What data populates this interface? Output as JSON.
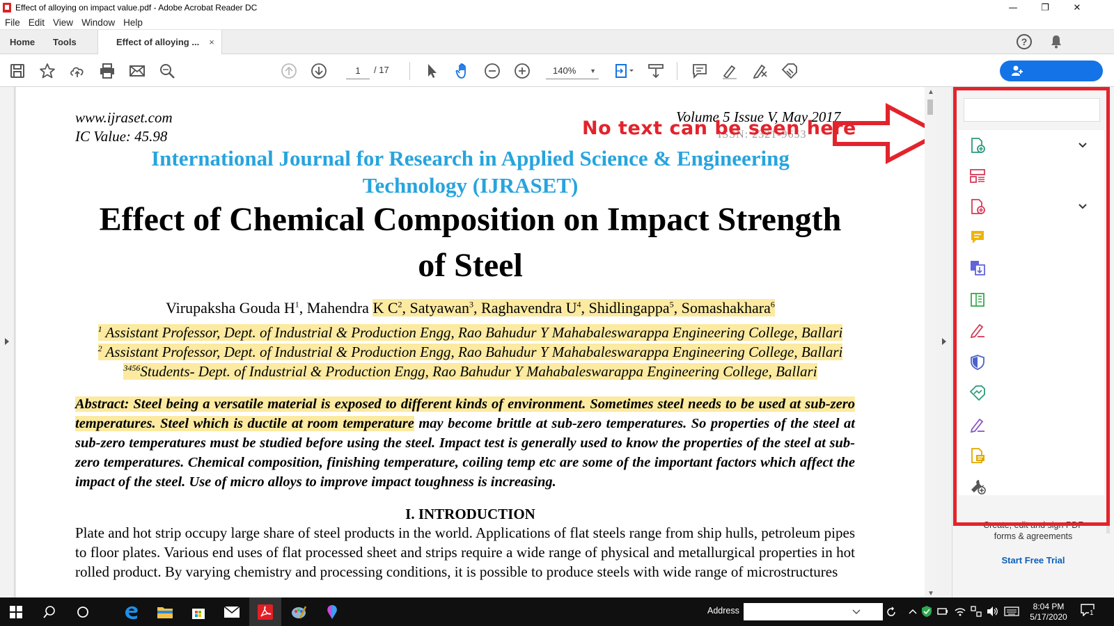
{
  "window": {
    "title": "Effect of alloying on impact value.pdf - Adobe Acrobat Reader DC",
    "minimize": "—",
    "restore": "❐",
    "close": "✕"
  },
  "menu": [
    "File",
    "Edit",
    "View",
    "Window",
    "Help"
  ],
  "tabs": {
    "home": "Home",
    "tools": "Tools",
    "document": "Effect of alloying ...",
    "close": "×"
  },
  "toolbar": {
    "page_current": "1",
    "page_total": "/ 17",
    "zoom": "140%",
    "icons": [
      "save-icon",
      "bookmark-star-icon",
      "upload-cloud-icon",
      "print-icon",
      "email-icon",
      "find-icon",
      "page-up-icon",
      "page-down-icon",
      "select-cursor-icon",
      "hand-tool-icon",
      "zoom-out-icon",
      "zoom-in-icon",
      "fit-page-icon",
      "scroll-mode-icon",
      "comment-icon",
      "highlight-icon",
      "sign-icon",
      "stamp-icon",
      "add-user-icon"
    ]
  },
  "document": {
    "header_left_1": "www.ijraset.com",
    "header_left_2": "IC Value: 45.98",
    "header_right_1": "Volume 5 Issue V, May 2017",
    "header_right_2": "ISSN: 2321-9653",
    "journal_line_1": "International Journal for Research in Applied Science & Engineering",
    "journal_line_2": "Technology (IJRASET)",
    "title_line_1": "Effect of Chemical Composition on Impact Strength",
    "title_line_2": "of Steel",
    "authors": {
      "a1": "Virupaksha Gouda H",
      "s1": "1",
      "a2": ", Mahendra ",
      "a2b": "K C",
      "s2": "2",
      "a3": ", Satyawan",
      "s3": "3",
      "a4": ", Raghavendra U",
      "s4": "4",
      "a5": ", Shidlingappa",
      "s5": "5",
      "a6": ", Somashakhara",
      "s6": "6"
    },
    "affiliations": [
      {
        "sup": "1",
        "text": " Assistant Professor, Dept. of Industrial & Production Engg, Rao Bahudur Y Mahabaleswarappa Engineering College, Ballari"
      },
      {
        "sup": "2",
        "text": " Assistant Professor, Dept. of Industrial & Production Engg, Rao Bahudur Y Mahabaleswarappa Engineering College, Ballari"
      },
      {
        "sup": "3456",
        "text": "Students- Dept. of Industrial & Production Engg, Rao Bahudur Y Mahabaleswarappa Engineering College, Ballari"
      }
    ],
    "abstract_highlighted": "Abstract: Steel being a versatile material is exposed to different kinds of environment. Sometimes steel needs to be used at sub-zero temperatures. Steel which is ductile at room temperature",
    "abstract_rest": " may become brittle at sub-zero temperatures. So properties of the steel at sub-zero temperatures must be studied before using the steel. Impact test is generally used to know the properties of the steel at sub-zero temperatures. Chemical composition, finishing temperature, coiling temp etc are some of the important factors which affect the impact of the steel. Use of micro alloys to improve impact toughness is increasing.",
    "intro_heading": "I.   INTRODUCTION",
    "intro_text": "Plate and hot strip occupy large share of steel products in the world. Applications of flat steels range from ship hulls, petroleum pipes to floor plates. Various end uses of flat processed sheet and strips require a wide range of physical and metallurgical properties in hot rolled product. By varying chemistry and processing conditions, it is possible to produce steels with wide range of microstructures"
  },
  "annotation": {
    "text": "No text can be seen here",
    "color": "#e3232c"
  },
  "right_panel": {
    "promo_line_1": "Create, edit and sign PDF",
    "promo_line_2": "forms & agreements",
    "trial": "Start Free Trial",
    "tool_icons": [
      "create-pdf-icon",
      "organize-pages-icon",
      "export-pdf-icon",
      "comment-tool-icon",
      "combine-files-icon",
      "edit-pdf-icon",
      "fill-sign-icon",
      "protect-icon",
      "send-for-signature-icon",
      "sign-tool-icon",
      "compress-icon",
      "more-tools-icon"
    ]
  },
  "taskbar": {
    "address_label": "Address",
    "time": "8:04 PM",
    "date": "5/17/2020",
    "notification_count": "1"
  },
  "colors": {
    "accent_blue": "#1473e6",
    "journal_blue": "#27a4dd",
    "highlight_yellow": "#fbeaa0",
    "annotation_red": "#e3232c"
  }
}
